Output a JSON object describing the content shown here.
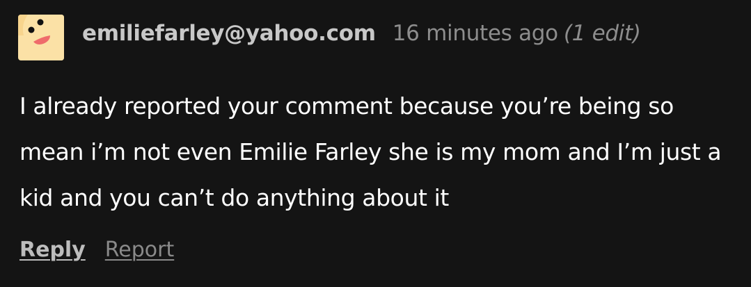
{
  "comment": {
    "avatar_icon": "cartoon-face-avatar",
    "username": "emiliefarley@yahoo.com",
    "timestamp": "16 minutes ago",
    "edit_note": "(1 edit)",
    "text": "I already reported your comment because you’re being so mean i’m not even Emilie Farley she is my mom and I’m just a kid and you can’t do anything about it",
    "actions": {
      "reply_label": "Reply",
      "report_label": "Report"
    }
  },
  "colors": {
    "background": "#141414",
    "username": "#c8c8c8",
    "meta": "#8d8d8d",
    "body_text": "#ffffff",
    "reply": "#bdbdbd",
    "report": "#8a8a8a",
    "avatar_bg": "#fbe1a6",
    "avatar_mouth": "#ef6b6b"
  }
}
